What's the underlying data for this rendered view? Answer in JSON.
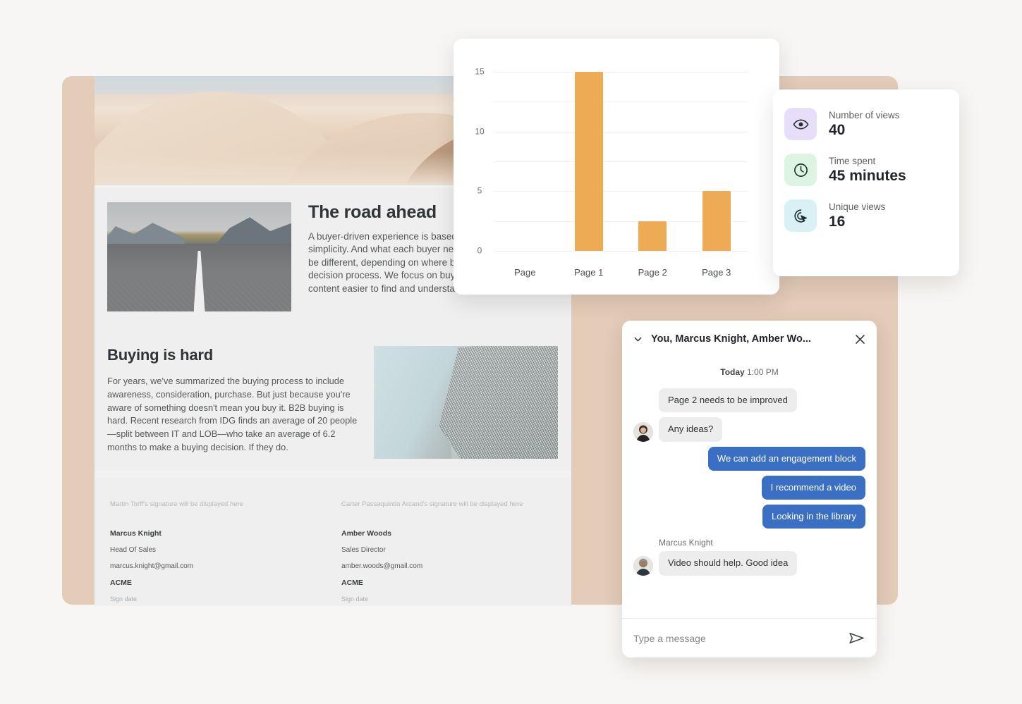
{
  "document": {
    "hero_image": "desert-dunes-photo",
    "road_section": {
      "image": "open-road-photo",
      "title": "The road ahead",
      "body": "A buyer-driven experience is based on choice, and simplicity. And what each buyer needs in the moment may be different, depending on where buyers are in their decision process. We focus on buyer enablement by making content easier to find and understand, select, and buy."
    },
    "buying_section": {
      "title": "Buying is hard",
      "body": "For years, we've summarized the buying process to include awareness, consideration, purchase. But just because you're aware of something doesn't mean you buy it. B2B buying is hard. Recent research from IDG finds an average of 20 people—split between IT and LOB—who take an average of 6.2 months to make a buying decision. If they do.",
      "image": "mesh-fabric-photo"
    },
    "signatures": [
      {
        "placeholder": "Martin Torff's signature will be displayed here",
        "name": "Marcus Knight",
        "role": "Head Of Sales",
        "email": "marcus.knight@gmail.com",
        "company": "ACME",
        "date_label": "Sign date"
      },
      {
        "placeholder": "Carter Passaquintio Arcand's signature will be displayed here",
        "name": "Amber Woods",
        "role": "Sales Director",
        "email": "amber.woods@gmail.com",
        "company": "ACME",
        "date_label": "Sign date"
      }
    ]
  },
  "chart_data": {
    "type": "bar",
    "title": "",
    "categories": [
      "Page",
      "Page 1",
      "Page 2",
      "Page 3"
    ],
    "values": [
      0,
      15,
      2.5,
      5
    ],
    "xlabel": "",
    "ylabel": "",
    "ylim": [
      0,
      16
    ],
    "ytick_labels": [
      "15",
      "10",
      "5",
      "0"
    ],
    "ytick_values": [
      15,
      10,
      5,
      0
    ],
    "gridlines": [
      15,
      12.5,
      10,
      7.5,
      5,
      2.5,
      0
    ],
    "grid": true,
    "legend": "none",
    "bar_color": "#eeab55"
  },
  "stats": {
    "items": [
      {
        "icon": "eye-icon",
        "label": "Number of views",
        "value": "40",
        "tile_color": "#e7defa",
        "icon_color": "#2a2f36"
      },
      {
        "icon": "clock-icon",
        "label": "Time spent",
        "value": "45 minutes",
        "tile_color": "#ddf4e3",
        "icon_color": "#23302a"
      },
      {
        "icon": "click-target-icon",
        "label": "Unique views",
        "value": "16",
        "tile_color": "#d9f1f4",
        "icon_color": "#1f2c33"
      }
    ]
  },
  "chat": {
    "title": "You, Marcus Knight, Amber Wo...",
    "collapse_icon": "chevron-down-icon",
    "close_icon": "close-icon",
    "timestamp_day": "Today",
    "timestamp_time": "1:00 PM",
    "messages": [
      {
        "side": "in",
        "text": "Page 2 needs to be improved",
        "avatar": false,
        "sender": ""
      },
      {
        "side": "in",
        "text": "Any ideas?",
        "avatar": true,
        "sender": ""
      },
      {
        "side": "out",
        "text": "We can add an engagement block",
        "avatar": false,
        "sender": ""
      },
      {
        "side": "out",
        "text": "I recommend a video",
        "avatar": false,
        "sender": ""
      },
      {
        "side": "out",
        "text": "Looking in the library",
        "avatar": false,
        "sender": ""
      },
      {
        "side": "in",
        "text": "Video should help. Good idea",
        "avatar": true,
        "sender": "Marcus Knight"
      }
    ],
    "input_placeholder": "Type a message",
    "send_icon": "send-icon"
  }
}
